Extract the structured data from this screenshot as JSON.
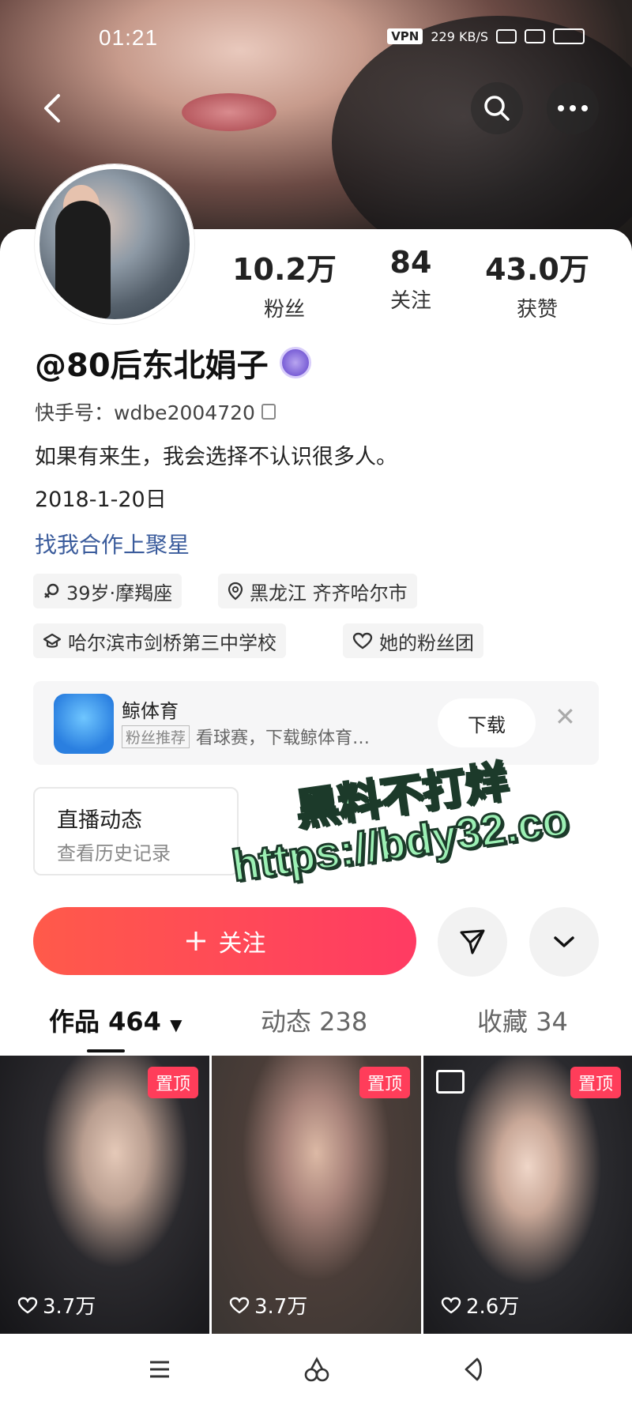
{
  "status_bar": {
    "time": "01:21",
    "vpn": "VPN",
    "speed": "229 KB/S"
  },
  "profile": {
    "stats": [
      {
        "value": "10.2万",
        "label": "粉丝"
      },
      {
        "value": "84",
        "label": "关注"
      },
      {
        "value": "43.0万",
        "label": "获赞"
      }
    ],
    "name": "@80后东北娟子",
    "id_line": "快手号：wdbe2004720",
    "bio": "如果有来生，我会选择不认识很多人。",
    "date": "2018-1-20日",
    "collab_link": "找我合作上聚星",
    "tags": [
      {
        "icon": "gender-female-icon",
        "text": "39岁·摩羯座"
      },
      {
        "icon": "location-icon",
        "text": "黑龙江 齐齐哈尔市"
      },
      {
        "icon": "school-icon",
        "text": "哈尔滨市剑桥第三中学校"
      },
      {
        "icon": "heart-icon",
        "text": "她的粉丝团"
      }
    ]
  },
  "ad": {
    "title": "鲸体育",
    "badge": "粉丝推荐",
    "desc": "看球赛，下载鲸体育…",
    "download_label": "下载"
  },
  "live": {
    "title": "直播动态",
    "subtitle": "查看历史记录"
  },
  "watermark": {
    "line1": "黑料不打烊",
    "line2": "https://bdy32.co"
  },
  "actions": {
    "follow_label": "关注"
  },
  "tabs": [
    {
      "label": "作品 464"
    },
    {
      "label": "动态 238"
    },
    {
      "label": "收藏 34"
    }
  ],
  "videos": [
    {
      "pin": "置顶",
      "likes": "3.7万"
    },
    {
      "pin": "置顶",
      "likes": "3.7万"
    },
    {
      "pin": "置顶",
      "likes": "2.6万"
    }
  ],
  "colors": {
    "accent": "#ff3b63",
    "pin": "#ff3d5a",
    "link": "#3b5c9c",
    "watermark": "#9cf0b4"
  }
}
